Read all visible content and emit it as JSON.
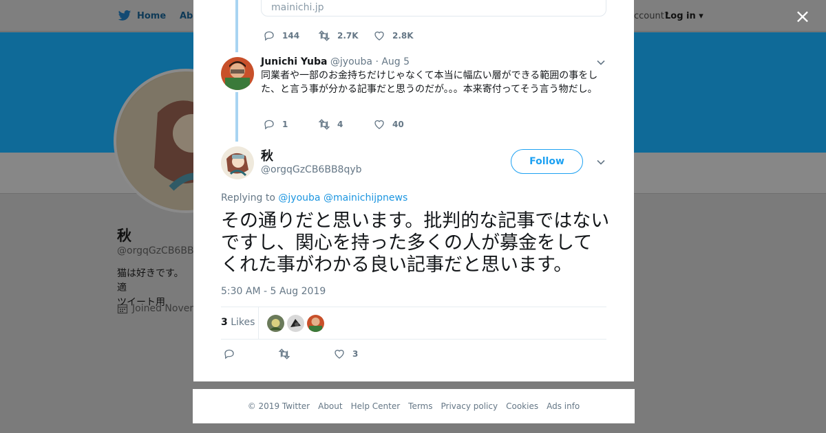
{
  "background": {
    "nav": {
      "home_label": "Home",
      "about_label": "Abo",
      "account_prompt": "ccount?",
      "login_label": "Log in"
    },
    "profile": {
      "name": "秋",
      "handle": "@orgqGzCB6BB8",
      "bio_line1": "猫は好きです。適",
      "bio_line2": "ツイート用",
      "joined": "Joined Novem"
    }
  },
  "modal": {
    "close_label": "×",
    "previous_link_domain": "mainichi.jp",
    "previous_actions": {
      "replies": "144",
      "retweets": "2.7K",
      "likes": "2.8K"
    },
    "reply_tweet": {
      "name": "Junichi Yuba",
      "handle": "@jyouba",
      "date": "· Aug 5",
      "text": "同業者や一部のお金持ちだけじゃなくて本当に幅広い層ができる範囲の事をした、と言う事が分かる記事だと思うのだが。。。本来寄付ってそう言う物だし。",
      "actions": {
        "replies": "1",
        "retweets": "4",
        "likes": "40"
      }
    },
    "main_tweet": {
      "name": "秋",
      "handle": "@orgqGzCB6BB8qyb",
      "follow_label": "Follow",
      "replying_prefix": "Replying to",
      "replying_to_1": "@jyouba",
      "replying_to_2": "@mainichijpnews",
      "text": "その通りだと思います。批判的な記事ではないですし、関心を持った多くの人が募金をしてくれた事がわかる良い記事だと思います。",
      "timestamp": "5:30 AM - 5 Aug 2019",
      "likes_count": "3",
      "likes_label": "Likes",
      "actions": {
        "likes": "3"
      }
    }
  },
  "footer": {
    "links": [
      "© 2019 Twitter",
      "About",
      "Help Center",
      "Terms",
      "Privacy policy",
      "Cookies",
      "Ads info"
    ]
  },
  "colors": {
    "accent": "#1da1f2",
    "thread_line": "#a8d4f2",
    "overlay": "#7b7b7b"
  }
}
